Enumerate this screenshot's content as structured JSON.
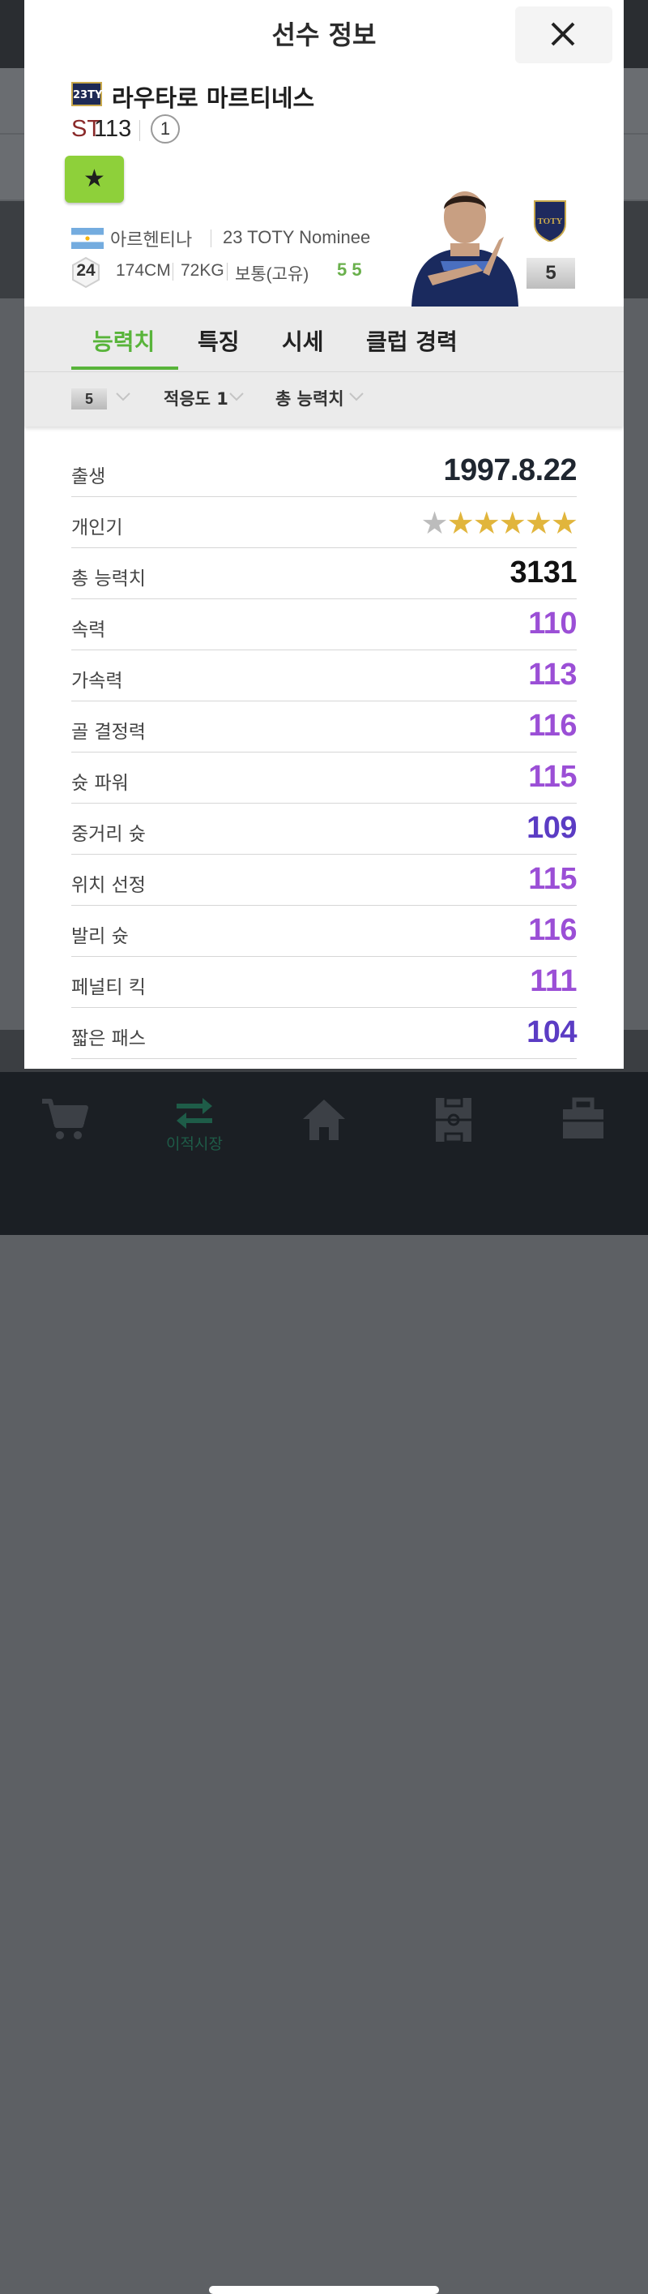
{
  "modal": {
    "title": "선수 정보",
    "player": {
      "season_badge": "23TY",
      "name": "라우타로 마르티네스",
      "position": "ST",
      "overall": "113",
      "rank": "1",
      "favorite_symbol": "★",
      "nation": "아르헨티나",
      "season_name": "23 TOTY Nominee",
      "age": "24",
      "height": "174CM",
      "weight": "72KG",
      "body_type": "보통(고유)",
      "foot": "5 5",
      "enhance_level": "5",
      "crest_text": "TOTY"
    },
    "tabs": [
      {
        "label": "능력치",
        "active": true
      },
      {
        "label": "특징",
        "active": false
      },
      {
        "label": "시세",
        "active": false
      },
      {
        "label": "클럽 경력",
        "active": false
      }
    ],
    "filters": {
      "level": "5",
      "adaptation": "적응도 1",
      "sort": "총 능력치"
    },
    "info_rows": {
      "birth_label": "출생",
      "birth_value": "1997.8.22",
      "popularity_label": "개인기",
      "popularity_stars": 5,
      "popularity_max": 6,
      "total_label": "총 능력치",
      "total_value": "3131"
    },
    "stats": [
      {
        "label": "속력",
        "value": "110",
        "color": "#9b4fd6"
      },
      {
        "label": "가속력",
        "value": "113",
        "color": "#9b4fd6"
      },
      {
        "label": "골 결정력",
        "value": "116",
        "color": "#9b4fd6"
      },
      {
        "label": "슛 파워",
        "value": "115",
        "color": "#9b4fd6"
      },
      {
        "label": "중거리 슛",
        "value": "109",
        "color": "#5b3cc4"
      },
      {
        "label": "위치 선정",
        "value": "115",
        "color": "#9b4fd6"
      },
      {
        "label": "발리 슛",
        "value": "116",
        "color": "#9b4fd6"
      },
      {
        "label": "페널티 킥",
        "value": "111",
        "color": "#9b4fd6"
      },
      {
        "label": "짧은 패스",
        "value": "104",
        "color": "#5b3cc4"
      }
    ]
  },
  "tabbar": {
    "items": [
      {
        "label": "",
        "icon": "cart-icon"
      },
      {
        "label": "이적시장",
        "icon": "transfer-icon"
      },
      {
        "label": "",
        "icon": "home-icon"
      },
      {
        "label": "",
        "icon": "pitch-icon"
      },
      {
        "label": "",
        "icon": "locker-icon"
      }
    ]
  },
  "colors": {
    "accent_green": "#58b43a",
    "stat_purple": "#9b4fd6",
    "stat_indigo": "#5b3cc4"
  }
}
